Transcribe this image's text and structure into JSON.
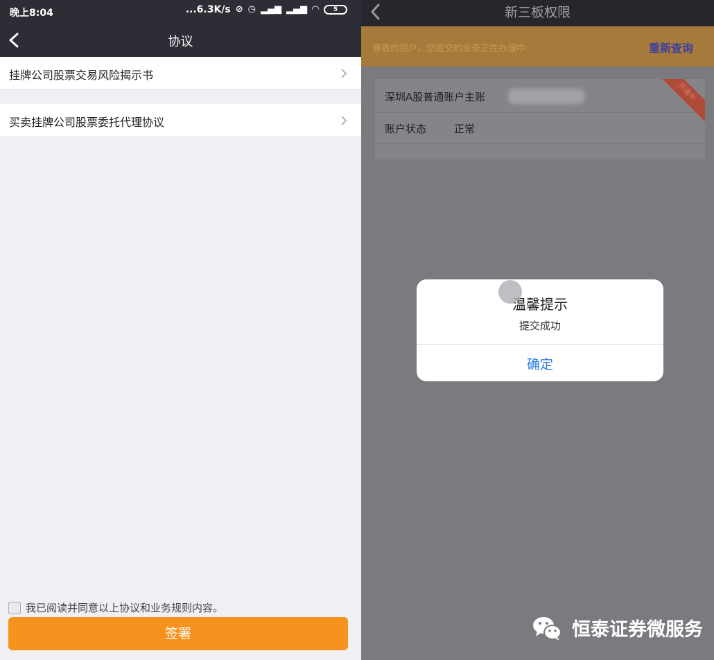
{
  "left_screen": {
    "status_bar": {
      "time": "晚上8:04",
      "speed": "...6.3K/s",
      "battery": "5"
    },
    "nav": {
      "title": "协议"
    },
    "agreements": [
      {
        "label": "挂牌公司股票交易风险揭示书"
      },
      {
        "label": "买卖挂牌公司股票委托代理协议"
      }
    ],
    "agree_text": "我已阅读并同意以上协议和业务规则内容。",
    "sign_button": "签署",
    "colors": {
      "nav_bg": "#2c2d35",
      "accent": "#f6921e",
      "page_bg": "#f0eff4"
    }
  },
  "right_screen": {
    "nav": {
      "title": "新三板权限"
    },
    "notice": {
      "message": "尊敬的用户，您提交的业务正在办理中",
      "action": "重新查询"
    },
    "account": {
      "line1": "深圳A股普通账户主账",
      "status_label": "账户状态",
      "status_value": "正常",
      "ribbon": "开通中"
    },
    "dialog": {
      "title": "温馨提示",
      "message": "提交成功",
      "ok": "确定"
    },
    "watermark": "恒泰证券微服务",
    "colors": {
      "overlay": "#7a7a7f",
      "link": "#2f7de1"
    }
  }
}
